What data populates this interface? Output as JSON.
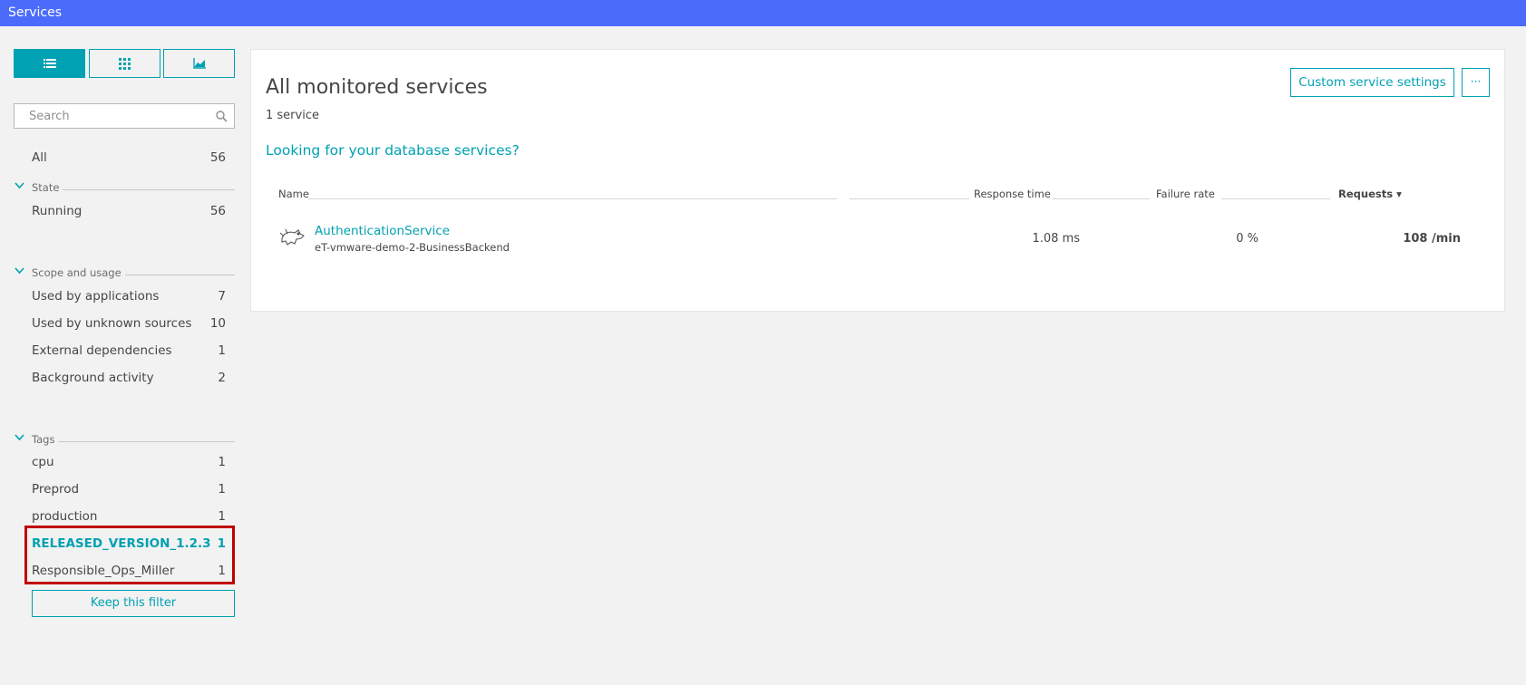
{
  "topbar": {
    "title": "Services"
  },
  "sidebar": {
    "search": {
      "placeholder": "Search",
      "value": ""
    },
    "all": {
      "label": "All",
      "count": "56"
    },
    "sections": {
      "state": {
        "title": "State",
        "items": [
          {
            "label": "Running",
            "count": "56"
          }
        ]
      },
      "scope": {
        "title": "Scope and usage",
        "items": [
          {
            "label": "Used by applications",
            "count": "7"
          },
          {
            "label": "Used by unknown sources",
            "count": "10"
          },
          {
            "label": "External dependencies",
            "count": "1"
          },
          {
            "label": "Background activity",
            "count": "2"
          }
        ]
      },
      "tags": {
        "title": "Tags",
        "items": [
          {
            "label": "cpu",
            "count": "1"
          },
          {
            "label": "Preprod",
            "count": "1"
          },
          {
            "label": "production",
            "count": "1"
          },
          {
            "label": "RELEASED_VERSION_1.2.3",
            "count": "1",
            "selected": true
          },
          {
            "label": "Responsible_Ops_Miller",
            "count": "1"
          }
        ]
      }
    },
    "keep_filter_label": "Keep this filter"
  },
  "main": {
    "title": "All monitored services",
    "count_text": "1 service",
    "db_link": "Looking for your database services?",
    "custom_settings_button": "Custom service settings",
    "more_button": "···",
    "table": {
      "headers": {
        "name": "Name",
        "response_time": "Response time",
        "failure_rate": "Failure rate",
        "requests": "Requests ▾"
      },
      "rows": [
        {
          "name": "AuthenticationService",
          "subtitle": "eT-vmware-demo-2-BusinessBackend",
          "response_time": "1.08 ms",
          "failure_rate": "0 %",
          "requests": "108 /min",
          "icon": "tomcat-icon"
        }
      ]
    }
  },
  "colors": {
    "topbar": "#4b6cfb",
    "accent": "#00a1b2",
    "highlight": "#c00000"
  }
}
